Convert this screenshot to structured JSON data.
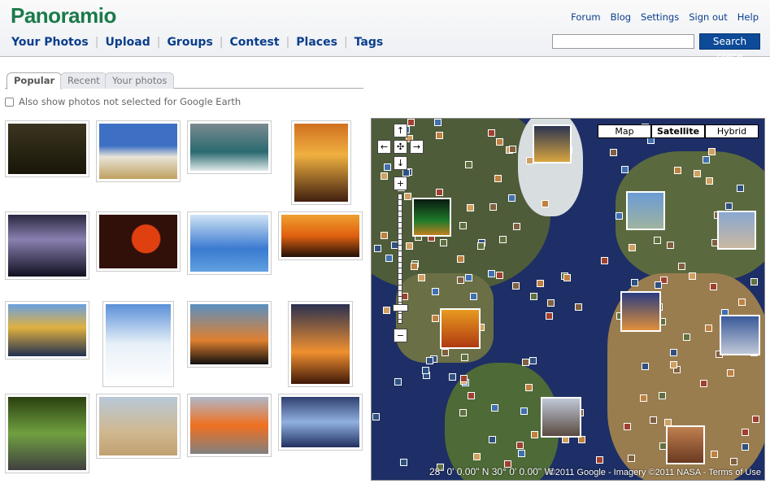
{
  "header": {
    "logo": "Panoramio",
    "nav": [
      "Your Photos",
      "Upload",
      "Groups",
      "Contest",
      "Places",
      "Tags"
    ],
    "top_links": [
      "Forum",
      "Blog",
      "Settings",
      "Sign out",
      "Help"
    ],
    "search_value": "",
    "search_button": "Search place"
  },
  "tabs": [
    "Popular",
    "Recent",
    "Your photos"
  ],
  "active_tab": "Popular",
  "ge_checkbox": {
    "label": "Also show photos not selected for Google Earth",
    "checked": false
  },
  "photos": [
    {
      "desc": "leopard-tree"
    },
    {
      "desc": "cathedral"
    },
    {
      "desc": "wave"
    },
    {
      "desc": "sunset-lake"
    },
    {
      "desc": "lightning"
    },
    {
      "desc": "plane-sun"
    },
    {
      "desc": "ice-cave"
    },
    {
      "desc": "industrial-sunset"
    },
    {
      "desc": "harbor"
    },
    {
      "desc": "snow-trees"
    },
    {
      "desc": "tree-silhouette"
    },
    {
      "desc": "tree-sunset"
    },
    {
      "desc": "tree-tunnel"
    },
    {
      "desc": "ship-desert"
    },
    {
      "desc": "volcano"
    },
    {
      "desc": "reflection"
    }
  ],
  "map": {
    "types": [
      "Map",
      "Satellite",
      "Hybrid"
    ],
    "selected_type": "Satellite",
    "coords": "28° 0' 0.00\" N 30° 0' 0.00\" W",
    "attribution": "©2011 Google - Imagery ©2011 NASA - Terms of Use"
  }
}
